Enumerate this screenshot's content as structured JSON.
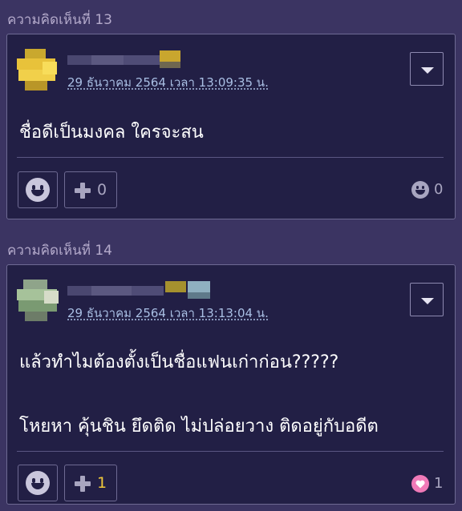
{
  "comments": [
    {
      "label": "ความคิดเห็นที่ 13",
      "timestamp": "29 ธันวาคม 2564 เวลา 13:09:35 น.",
      "lines": [
        "ชื่อดีเป็นมงคล ใครจะสน"
      ],
      "plus_count": "0",
      "reaction_icon": "smile-icon",
      "reaction_count": "0",
      "colors": {
        "plus_count": "#a8a5c0",
        "reaction_face": "#a8a5c0"
      }
    },
    {
      "label": "ความคิดเห็นที่ 14",
      "timestamp": "29 ธันวาคม 2564 เวลา 13:13:04 น.",
      "lines": [
        "แล้วทำไมต้องตั้งเป็นชื่อแฟนเก่าก่อน?????",
        "โหยหา คุ้นชิน ยึดติด ไม่ปล่อยวาง ติดอยู่กับอดีต"
      ],
      "plus_count": "1",
      "reaction_icon": "heart-icon",
      "reaction_count": "1",
      "colors": {
        "plus_count": "#f0c83a",
        "reaction_face": "#f07ab8"
      }
    }
  ],
  "theme": {
    "background": "#3b3462",
    "card": "#221f45",
    "border": "#6e6a93",
    "label_text": "#b4aacb",
    "timestamp_link": "#a9bfe4"
  }
}
